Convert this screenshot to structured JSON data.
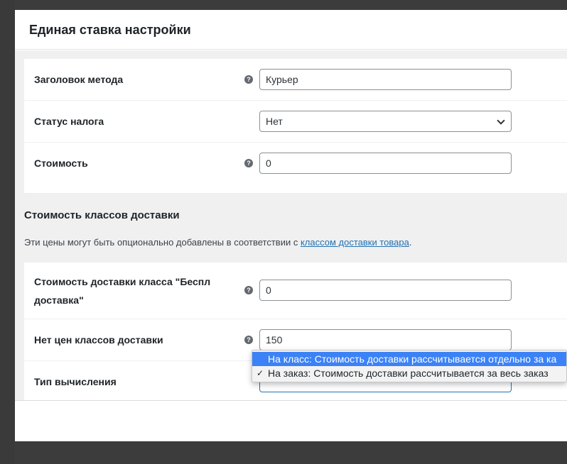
{
  "modal": {
    "title": "Единая ставка настройки"
  },
  "fields": {
    "method_title": {
      "label": "Заголовок метода",
      "value": "Курьер"
    },
    "tax_status": {
      "label": "Статус налога",
      "value": "Нет"
    },
    "cost": {
      "label": "Стоимость",
      "value": "0"
    }
  },
  "shipping_classes": {
    "title": "Стоимость классов доставки",
    "desc_prefix": "Эти цены могут быть опционально добавлены в соответствии с ",
    "desc_link": "классом доставки товара",
    "desc_suffix": ".",
    "free_class_label": "Стоимость доставки класса \"Беспл доставка\"",
    "free_class_value": "0",
    "no_class_label": "Нет цен классов доставки",
    "no_class_value": "150",
    "calc_type_label": "Тип вычисления"
  },
  "calc_dropdown": {
    "options": [
      "На класс: Стоимость доставки рассчитывается отдельно за ка",
      "На заказ: Стоимость доставки рассчитывается за весь заказ"
    ],
    "highlighted_index": 0,
    "checked_index": 1,
    "check_mark": "✓"
  },
  "icons": {
    "help": "?"
  },
  "colors": {
    "link": "#2271b1",
    "highlight": "#3b82f6",
    "overlay": "#3c3c3c"
  }
}
